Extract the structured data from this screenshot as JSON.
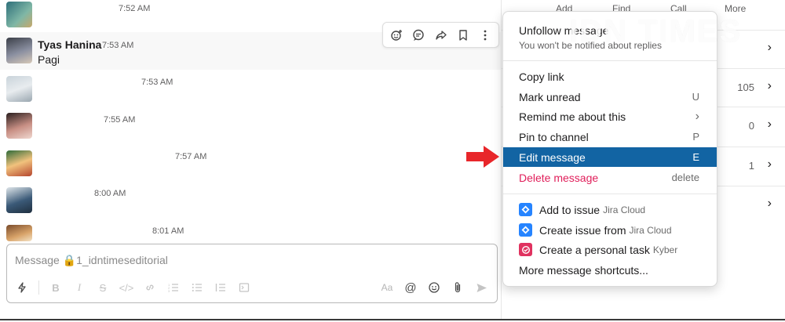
{
  "messages": [
    {
      "id": "m1",
      "name": "",
      "time": "7:52 AM",
      "text": ""
    },
    {
      "id": "m2",
      "name": "Tyas Hanina",
      "time": "7:53 AM",
      "text": "Pagi"
    },
    {
      "id": "m3",
      "name": "",
      "time": "7:53 AM",
      "text": ""
    },
    {
      "id": "m4",
      "name": "",
      "time": "7:55 AM",
      "text": ""
    },
    {
      "id": "m5",
      "name": "",
      "time": "7:57 AM",
      "text": ""
    },
    {
      "id": "m6",
      "name": "",
      "time": "8:00 AM",
      "text": ""
    },
    {
      "id": "m7",
      "name": "",
      "time": "8:01 AM",
      "text": ""
    }
  ],
  "composer": {
    "placeholder": "Message 🔒1_idntimeseditorial"
  },
  "details": {
    "tabs": [
      "Add",
      "Find",
      "Call",
      "More"
    ],
    "rows": [
      {
        "count": ""
      },
      {
        "count": "105"
      },
      {
        "count": "0"
      },
      {
        "count": "1"
      },
      {
        "count": ""
      }
    ],
    "chevron": "›"
  },
  "watermark": "IDN TIMES",
  "menu": {
    "header_title": "Unfollow message",
    "header_sub": "You won't be notified about replies",
    "items": [
      {
        "label": "Copy link",
        "hint": ""
      },
      {
        "label": "Mark unread",
        "hint": "U"
      },
      {
        "label": "Remind me about this",
        "hint": "›"
      },
      {
        "label": "Pin to channel",
        "hint": "P"
      },
      {
        "label": "Edit message",
        "hint": "E"
      },
      {
        "label": "Delete message",
        "hint": "delete"
      }
    ],
    "apps": [
      {
        "label": "Add to issue",
        "source": "Jira Cloud"
      },
      {
        "label": "Create issue from",
        "source": "Jira Cloud"
      },
      {
        "label": "Create a personal task",
        "source": "Kyber"
      }
    ],
    "more": "More message shortcuts..."
  },
  "colors": {
    "active": "#1264a3",
    "danger": "#e01e5a",
    "arrow": "#e8262a",
    "jira": "#2684ff",
    "kyber": "#e0325f"
  }
}
